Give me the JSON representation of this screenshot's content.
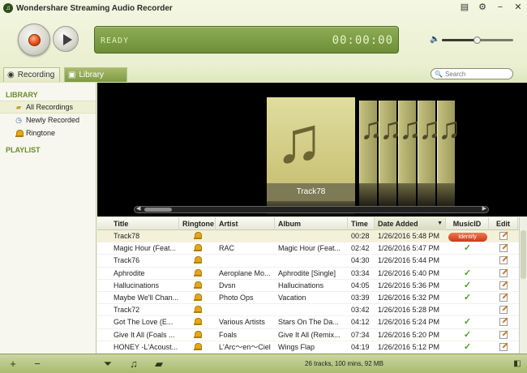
{
  "app": {
    "title": "Wondershare Streaming Audio Recorder"
  },
  "display": {
    "status": "READY",
    "time": "00:00:00"
  },
  "volume": {
    "level": 0.5
  },
  "tabs": [
    {
      "label": "Recording"
    },
    {
      "label": "Library"
    }
  ],
  "search": {
    "placeholder": "Search"
  },
  "sidebar": {
    "library_header": "LIBRARY",
    "items": [
      {
        "label": "All Recordings",
        "icon": "folder-icon",
        "selected": true
      },
      {
        "label": "Newly Recorded",
        "icon": "clock-icon"
      },
      {
        "label": "Ringtone",
        "icon": "bell-icon"
      }
    ],
    "playlist_header": "PLAYLIST"
  },
  "coverflow": {
    "current_label": "Track78"
  },
  "table": {
    "columns": [
      "Title",
      "Ringtone",
      "Artist",
      "Album",
      "Time",
      "Date Added",
      "MusicID",
      "Edit"
    ],
    "rows": [
      {
        "title": "Track78",
        "artist": "",
        "album": "",
        "time": "00:28",
        "date": "1/26/2016 5:48 PM",
        "musicid": "identify",
        "selected": true
      },
      {
        "title": "Magic Hour (Feat...",
        "artist": "RAC",
        "album": "Magic Hour (Feat...",
        "time": "02:42",
        "date": "1/26/2016 5:47 PM",
        "musicid": "check"
      },
      {
        "title": "Track76",
        "artist": "",
        "album": "",
        "time": "04:30",
        "date": "1/26/2016 5:44 PM",
        "musicid": ""
      },
      {
        "title": "Aphrodite",
        "artist": "Aeroplane Mo...",
        "album": "Aphrodite [Single]",
        "time": "03:34",
        "date": "1/26/2016 5:40 PM",
        "musicid": "check"
      },
      {
        "title": "Hallucinations",
        "artist": "Dvsn",
        "album": "Hallucinations",
        "time": "04:05",
        "date": "1/26/2016 5:36 PM",
        "musicid": "check"
      },
      {
        "title": "Maybe We'll Chan...",
        "artist": "Photo Ops",
        "album": "Vacation",
        "time": "03:39",
        "date": "1/26/2016 5:32 PM",
        "musicid": "check"
      },
      {
        "title": "Track72",
        "artist": "",
        "album": "",
        "time": "03:42",
        "date": "1/26/2016 5:28 PM",
        "musicid": ""
      },
      {
        "title": "Got The Love (E...",
        "artist": "Various Artists",
        "album": "Stars On The Da...",
        "time": "04:12",
        "date": "1/26/2016 5:24 PM",
        "musicid": "check"
      },
      {
        "title": "Give It All (Foals ...",
        "artist": "Foals",
        "album": "Give It All (Remix...",
        "time": "07:34",
        "date": "1/26/2016 5:20 PM",
        "musicid": "check"
      },
      {
        "title": "HONEY -L'Acoust...",
        "artist": "L'Arc～en～Ciel",
        "album": "Wings Flap",
        "time": "04:19",
        "date": "1/26/2016 5:12 PM",
        "musicid": "check"
      }
    ]
  },
  "status": {
    "summary": "26 tracks, 100 mins, 92 MB"
  },
  "colors": {
    "accent": "#7f9a44",
    "display_bg": "#7a9a44",
    "record_red": "#e04a12",
    "check_green": "#48a02a"
  }
}
